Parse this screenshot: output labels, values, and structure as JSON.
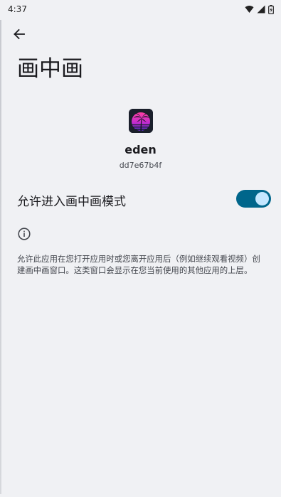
{
  "status_bar": {
    "time": "4:37",
    "icons": [
      "wifi-icon",
      "signal-icon",
      "battery-icon"
    ]
  },
  "header": {
    "back_icon": "arrow-left-icon",
    "title": "画中画"
  },
  "app": {
    "icon": "palm-tree-sunset-icon",
    "name": "eden",
    "package": "dd7e67b4f"
  },
  "setting": {
    "label": "允许进入画中画模式",
    "enabled": true
  },
  "info": {
    "icon": "info-icon",
    "description": "允许此应用在您打开应用时或您离开应用后（例如继续观看视频）创建画中画窗口。这类窗口会显示在您当前使用的其他应用的上层。"
  },
  "colors": {
    "background": "#f0f1f4",
    "toggle_track": "#00668b",
    "toggle_thumb": "#c4e7ff"
  }
}
